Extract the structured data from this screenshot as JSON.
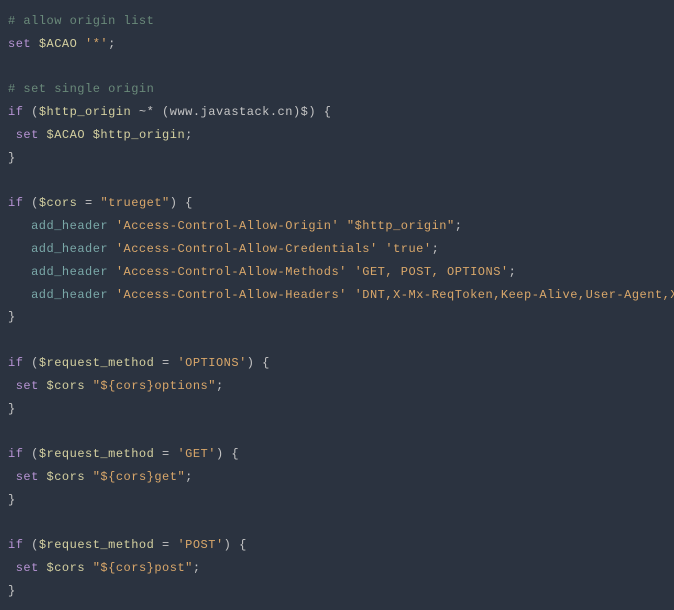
{
  "code": {
    "lines": [
      {
        "tokens": [
          {
            "class": "comment",
            "text": "# allow origin list"
          }
        ]
      },
      {
        "tokens": [
          {
            "class": "keyword",
            "text": "set"
          },
          {
            "class": "punctuation",
            "text": " "
          },
          {
            "class": "variable",
            "text": "$ACAO"
          },
          {
            "class": "punctuation",
            "text": " "
          },
          {
            "class": "string",
            "text": "'*'"
          },
          {
            "class": "punctuation",
            "text": ";"
          }
        ]
      },
      {
        "tokens": []
      },
      {
        "tokens": [
          {
            "class": "comment",
            "text": "# set single origin"
          }
        ]
      },
      {
        "tokens": [
          {
            "class": "keyword",
            "text": "if"
          },
          {
            "class": "punctuation",
            "text": " ("
          },
          {
            "class": "variable",
            "text": "$http_origin"
          },
          {
            "class": "punctuation",
            "text": " ~* (www.javastack.cn)$) {"
          }
        ]
      },
      {
        "tokens": [
          {
            "class": "punctuation",
            "text": " "
          },
          {
            "class": "keyword",
            "text": "set"
          },
          {
            "class": "punctuation",
            "text": " "
          },
          {
            "class": "variable",
            "text": "$ACAO"
          },
          {
            "class": "punctuation",
            "text": " "
          },
          {
            "class": "variable",
            "text": "$http_origin"
          },
          {
            "class": "punctuation",
            "text": ";"
          }
        ]
      },
      {
        "tokens": [
          {
            "class": "punctuation",
            "text": "}"
          }
        ]
      },
      {
        "tokens": []
      },
      {
        "tokens": [
          {
            "class": "keyword",
            "text": "if"
          },
          {
            "class": "punctuation",
            "text": " ("
          },
          {
            "class": "variable",
            "text": "$cors"
          },
          {
            "class": "punctuation",
            "text": " = "
          },
          {
            "class": "string",
            "text": "\"trueget\""
          },
          {
            "class": "punctuation",
            "text": ") {"
          }
        ]
      },
      {
        "tokens": [
          {
            "class": "punctuation",
            "text": "   "
          },
          {
            "class": "function",
            "text": "add_header"
          },
          {
            "class": "punctuation",
            "text": " "
          },
          {
            "class": "string",
            "text": "'Access-Control-Allow-Origin'"
          },
          {
            "class": "punctuation",
            "text": " "
          },
          {
            "class": "string",
            "text": "\"$http_origin\""
          },
          {
            "class": "punctuation",
            "text": ";"
          }
        ]
      },
      {
        "tokens": [
          {
            "class": "punctuation",
            "text": "   "
          },
          {
            "class": "function",
            "text": "add_header"
          },
          {
            "class": "punctuation",
            "text": " "
          },
          {
            "class": "string",
            "text": "'Access-Control-Allow-Credentials'"
          },
          {
            "class": "punctuation",
            "text": " "
          },
          {
            "class": "string",
            "text": "'true'"
          },
          {
            "class": "punctuation",
            "text": ";"
          }
        ]
      },
      {
        "tokens": [
          {
            "class": "punctuation",
            "text": "   "
          },
          {
            "class": "function",
            "text": "add_header"
          },
          {
            "class": "punctuation",
            "text": " "
          },
          {
            "class": "string",
            "text": "'Access-Control-Allow-Methods'"
          },
          {
            "class": "punctuation",
            "text": " "
          },
          {
            "class": "string",
            "text": "'GET, POST, OPTIONS'"
          },
          {
            "class": "punctuation",
            "text": ";"
          }
        ]
      },
      {
        "tokens": [
          {
            "class": "punctuation",
            "text": "   "
          },
          {
            "class": "function",
            "text": "add_header"
          },
          {
            "class": "punctuation",
            "text": " "
          },
          {
            "class": "string",
            "text": "'Access-Control-Allow-Headers'"
          },
          {
            "class": "punctuation",
            "text": " "
          },
          {
            "class": "string",
            "text": "'DNT,X-Mx-ReqToken,Keep-Alive,User-Agent,X-Requested-With,"
          }
        ]
      },
      {
        "tokens": [
          {
            "class": "punctuation",
            "text": "}"
          }
        ]
      },
      {
        "tokens": []
      },
      {
        "tokens": [
          {
            "class": "keyword",
            "text": "if"
          },
          {
            "class": "punctuation",
            "text": " ("
          },
          {
            "class": "variable",
            "text": "$request_method"
          },
          {
            "class": "punctuation",
            "text": " = "
          },
          {
            "class": "string",
            "text": "'OPTIONS'"
          },
          {
            "class": "punctuation",
            "text": ") {"
          }
        ]
      },
      {
        "tokens": [
          {
            "class": "punctuation",
            "text": " "
          },
          {
            "class": "keyword",
            "text": "set"
          },
          {
            "class": "punctuation",
            "text": " "
          },
          {
            "class": "variable",
            "text": "$cors"
          },
          {
            "class": "punctuation",
            "text": " "
          },
          {
            "class": "string",
            "text": "\"${cors}options\""
          },
          {
            "class": "punctuation",
            "text": ";"
          }
        ]
      },
      {
        "tokens": [
          {
            "class": "punctuation",
            "text": "}"
          }
        ]
      },
      {
        "tokens": []
      },
      {
        "tokens": [
          {
            "class": "keyword",
            "text": "if"
          },
          {
            "class": "punctuation",
            "text": " ("
          },
          {
            "class": "variable",
            "text": "$request_method"
          },
          {
            "class": "punctuation",
            "text": " = "
          },
          {
            "class": "string",
            "text": "'GET'"
          },
          {
            "class": "punctuation",
            "text": ") {"
          }
        ]
      },
      {
        "tokens": [
          {
            "class": "punctuation",
            "text": " "
          },
          {
            "class": "keyword",
            "text": "set"
          },
          {
            "class": "punctuation",
            "text": " "
          },
          {
            "class": "variable",
            "text": "$cors"
          },
          {
            "class": "punctuation",
            "text": " "
          },
          {
            "class": "string",
            "text": "\"${cors}get\""
          },
          {
            "class": "punctuation",
            "text": ";"
          }
        ]
      },
      {
        "tokens": [
          {
            "class": "punctuation",
            "text": "}"
          }
        ]
      },
      {
        "tokens": []
      },
      {
        "tokens": [
          {
            "class": "keyword",
            "text": "if"
          },
          {
            "class": "punctuation",
            "text": " ("
          },
          {
            "class": "variable",
            "text": "$request_method"
          },
          {
            "class": "punctuation",
            "text": " = "
          },
          {
            "class": "string",
            "text": "'POST'"
          },
          {
            "class": "punctuation",
            "text": ") {"
          }
        ]
      },
      {
        "tokens": [
          {
            "class": "punctuation",
            "text": " "
          },
          {
            "class": "keyword",
            "text": "set"
          },
          {
            "class": "punctuation",
            "text": " "
          },
          {
            "class": "variable",
            "text": "$cors"
          },
          {
            "class": "punctuation",
            "text": " "
          },
          {
            "class": "string",
            "text": "\"${cors}post\""
          },
          {
            "class": "punctuation",
            "text": ";"
          }
        ]
      },
      {
        "tokens": [
          {
            "class": "punctuation",
            "text": "}"
          }
        ]
      }
    ]
  }
}
